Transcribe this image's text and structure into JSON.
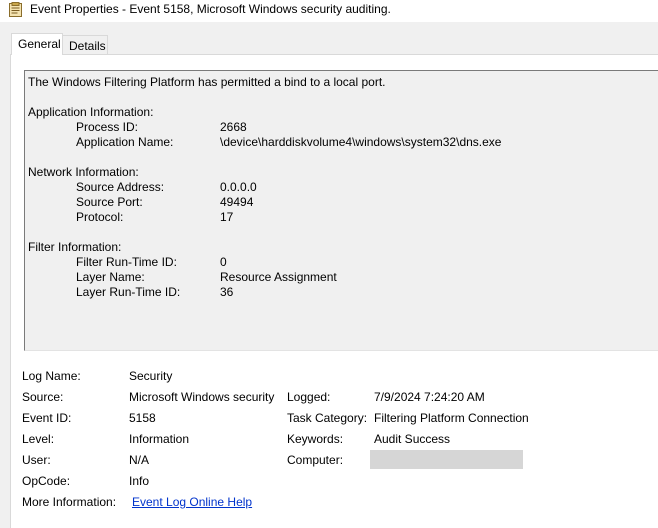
{
  "window": {
    "title": "Event Properties - Event 5158, Microsoft Windows security auditing.",
    "icon": "event-properties-icon"
  },
  "tabs": [
    {
      "label": "General",
      "active": true
    },
    {
      "label": "Details",
      "active": false
    }
  ],
  "description": {
    "summary": "The Windows Filtering Platform has permitted a bind to a local port.",
    "application_header": "Application Information:",
    "application": [
      {
        "label": "Process ID:",
        "value": "2668"
      },
      {
        "label": "Application Name:",
        "value": "\\device\\harddiskvolume4\\windows\\system32\\dns.exe"
      }
    ],
    "network_header": "Network Information:",
    "network": [
      {
        "label": "Source Address:",
        "value": "0.0.0.0"
      },
      {
        "label": "Source Port:",
        "value": "49494"
      },
      {
        "label": "Protocol:",
        "value": "17"
      }
    ],
    "filter_header": "Filter Information:",
    "filter": [
      {
        "label": "Filter Run-Time ID:",
        "value": "0"
      },
      {
        "label": "Layer Name:",
        "value": "Resource Assignment"
      },
      {
        "label": "Layer Run-Time ID:",
        "value": "36"
      }
    ]
  },
  "details": {
    "log_name_label": "Log Name:",
    "log_name": "Security",
    "source_label": "Source:",
    "source": "Microsoft Windows security",
    "logged_label": "Logged:",
    "logged": "7/9/2024 7:24:20 AM",
    "event_id_label": "Event ID:",
    "event_id": "5158",
    "task_category_label": "Task Category:",
    "task_category": "Filtering Platform Connection",
    "level_label": "Level:",
    "level": "Information",
    "keywords_label": "Keywords:",
    "keywords": "Audit Success",
    "user_label": "User:",
    "user": "N/A",
    "computer_label": "Computer:",
    "opcode_label": "OpCode:",
    "opcode": "Info",
    "more_info_label": "More Information:",
    "more_info_link": "Event Log Online Help"
  }
}
